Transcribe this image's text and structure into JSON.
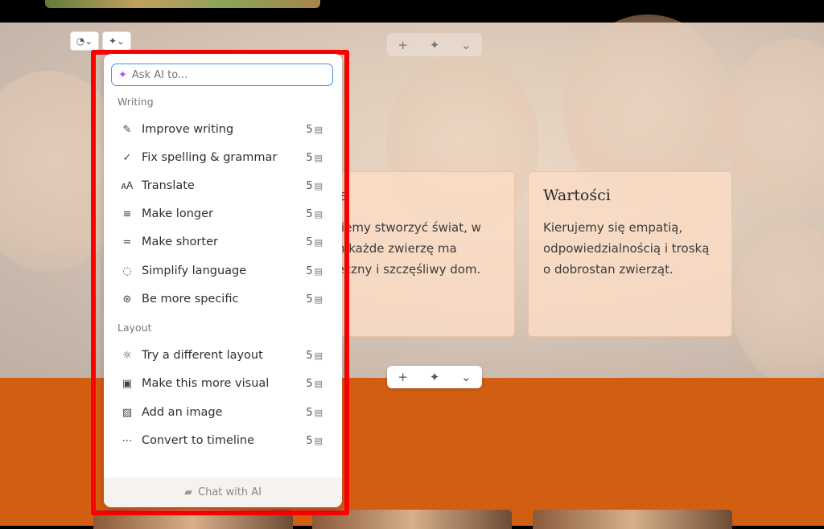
{
  "hero": {
    "card1": {
      "title": "zja",
      "text": "gniemy stworzyć świat, w\nym każde zwierzę ma\npieczny i szczęśliwy dom."
    },
    "card2": {
      "title": "Wartości",
      "text": "Kierujemy się empatią,\nodpowiedzialnością i troską\no dobrostan zwierząt."
    }
  },
  "toolbar": {
    "add": "+",
    "ai": "✦",
    "more": "⌄"
  },
  "ai_menu": {
    "search_placeholder": "Ask AI to...",
    "sections": {
      "writing": "Writing",
      "layout": "Layout"
    },
    "items": [
      {
        "label": "Improve writing",
        "icon": "pen-icon",
        "glyph": "✎",
        "cost": "5"
      },
      {
        "label": "Fix spelling & grammar",
        "icon": "check-icon",
        "glyph": "✓",
        "cost": "5"
      },
      {
        "label": "Translate",
        "icon": "translate-icon",
        "glyph": "🗚",
        "cost": "5"
      },
      {
        "label": "Make longer",
        "icon": "lines-longer-icon",
        "glyph": "≡",
        "cost": "5"
      },
      {
        "label": "Make shorter",
        "icon": "lines-shorter-icon",
        "glyph": "=",
        "cost": "5"
      },
      {
        "label": "Simplify language",
        "icon": "speech-bubble-icon",
        "glyph": "◌",
        "cost": "5"
      },
      {
        "label": "Be more specific",
        "icon": "target-icon",
        "glyph": "⊛",
        "cost": "5"
      },
      {
        "label": "Try a different layout",
        "icon": "lightbulb-icon",
        "glyph": "☼",
        "cost": "5"
      },
      {
        "label": "Make this more visual",
        "icon": "images-icon",
        "glyph": "▣",
        "cost": "5"
      },
      {
        "label": "Add an image",
        "icon": "image-icon",
        "glyph": "▨",
        "cost": "5"
      },
      {
        "label": "Convert to timeline",
        "icon": "timeline-icon",
        "glyph": "⋯",
        "cost": "5"
      }
    ],
    "chat_label": "Chat with AI"
  }
}
